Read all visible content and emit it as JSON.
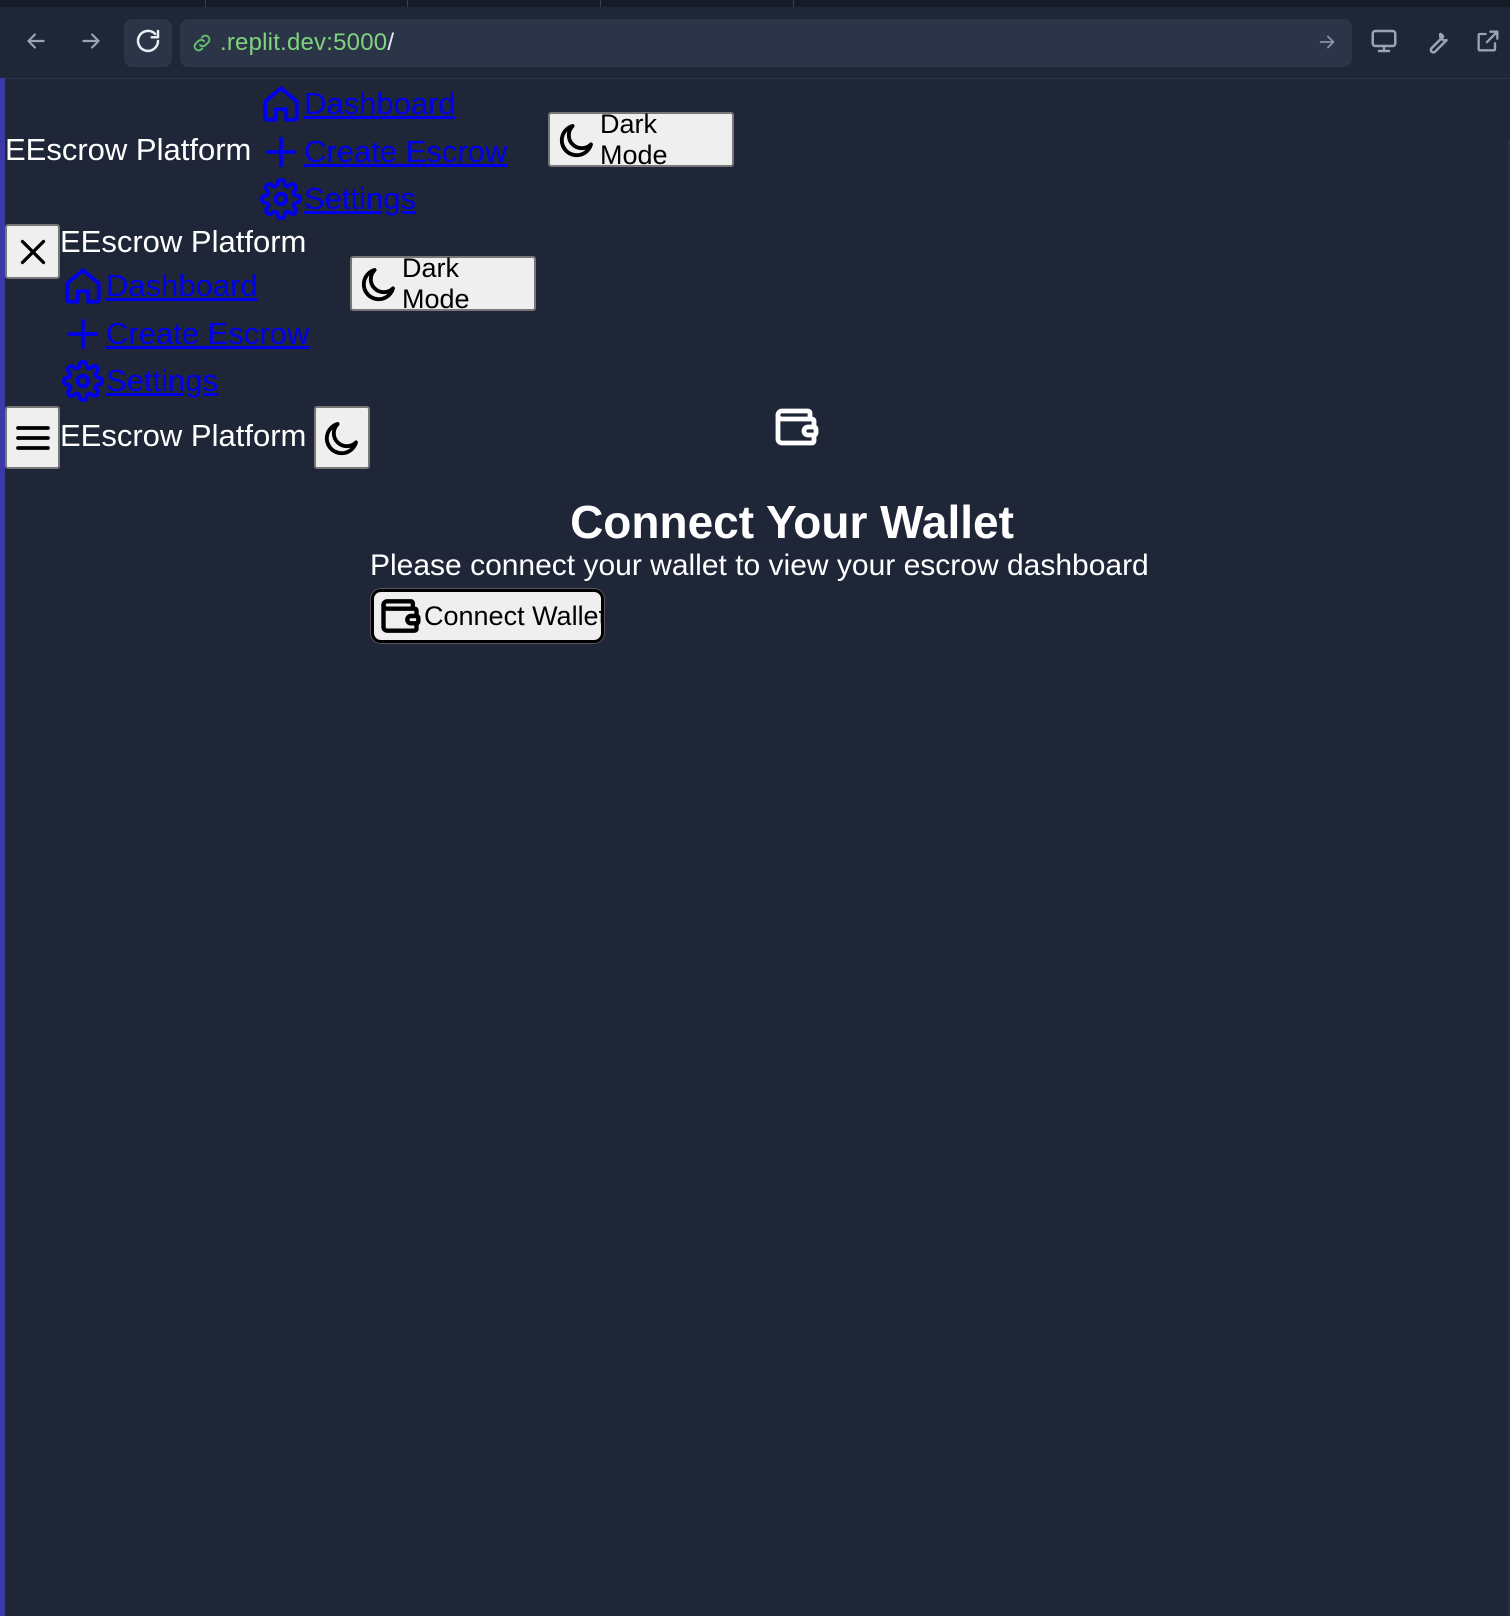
{
  "browser": {
    "url_host": ".replit.dev:5000",
    "url_path": "/",
    "back_icon": "arrow-left-icon",
    "forward_icon": "arrow-right-icon",
    "reload_icon": "reload-icon",
    "devices_icon": "monitor-icon",
    "tools_icon": "wrench-icon",
    "open_external_icon": "external-link-icon"
  },
  "header_desktop": {
    "brand": "EEscrow Platform",
    "nav": [
      {
        "label": "Dashboard",
        "icon": "home-icon"
      },
      {
        "label": "Create Escrow",
        "icon": "plus-icon"
      },
      {
        "label": "Settings",
        "icon": "gear-icon"
      }
    ],
    "theme_toggle_label": "Dark Mode"
  },
  "mobile_menu": {
    "close_icon": "close-icon",
    "brand": "EEscrow Platform",
    "nav": [
      {
        "label": "Dashboard",
        "icon": "home-icon"
      },
      {
        "label": "Create Escrow",
        "icon": "plus-icon"
      },
      {
        "label": "Settings",
        "icon": "gear-icon"
      }
    ],
    "theme_toggle_label": "Dark Mode"
  },
  "mobile_header": {
    "menu_icon": "hamburger-icon",
    "brand": "EEscrow Platform",
    "theme_icon": "moon-icon"
  },
  "main": {
    "icon": "wallet-icon",
    "heading": "Connect Your Wallet",
    "subtext": "Please connect your wallet to view your escrow dashboard",
    "connect_button_label": "Connect Wallet"
  },
  "colors": {
    "page_bg": "#1f2637",
    "link": "#0000ee",
    "url_host": "#7fd37e"
  }
}
